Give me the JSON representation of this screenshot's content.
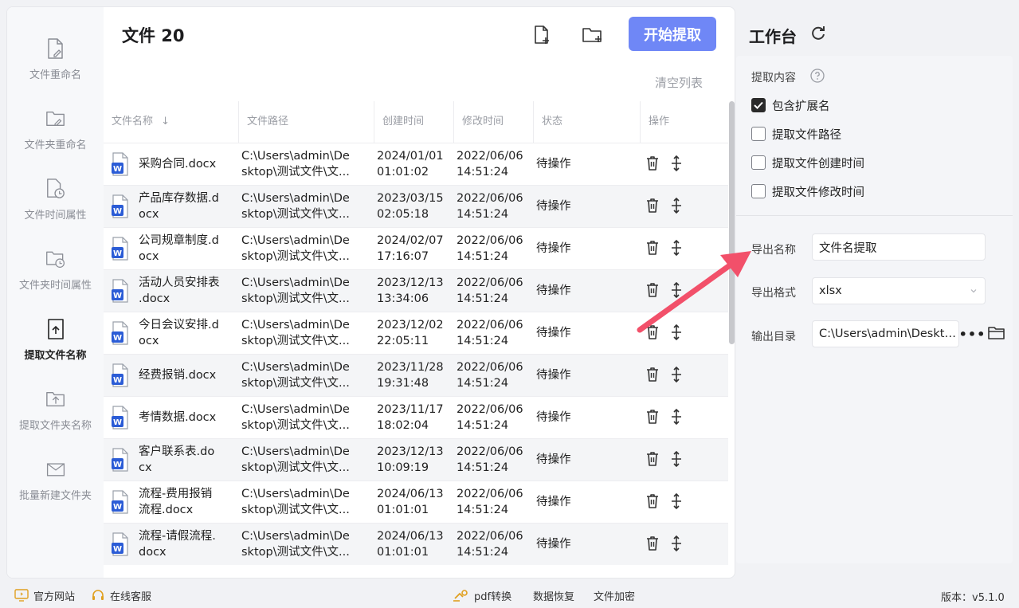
{
  "sidebar": {
    "items": [
      {
        "label": "文件重命名",
        "icon": "file-edit-icon",
        "active": false
      },
      {
        "label": "文件夹重命名",
        "icon": "folder-edit-icon",
        "active": false
      },
      {
        "label": "文件时间属性",
        "icon": "file-clock-icon",
        "active": false
      },
      {
        "label": "文件夹时间属性",
        "icon": "folder-clock-icon",
        "active": false
      },
      {
        "label": "提取文件名称",
        "icon": "file-upload-icon",
        "active": true
      },
      {
        "label": "提取文件夹名称",
        "icon": "folder-upload-icon",
        "active": false
      },
      {
        "label": "批量新建文件夹",
        "icon": "mail-folder-icon",
        "active": false
      }
    ]
  },
  "header": {
    "title": "文件 20",
    "start_button": "开始提取",
    "clear_list": "清空列表"
  },
  "table": {
    "columns": [
      "文件名称",
      "文件路径",
      "创建时间",
      "修改时间",
      "状态",
      "操作"
    ],
    "sort_indicator": "↓",
    "rows": [
      {
        "name": [
          "采购合同.docx"
        ],
        "path": [
          "C:\\Users\\admin\\De",
          "sktop\\测试文件\\文..."
        ],
        "ctime": [
          "2024/01/01",
          "01:01:02"
        ],
        "mtime": [
          "2022/06/06",
          "14:51:24"
        ],
        "status": "待操作"
      },
      {
        "name": [
          "产品库存数据.d",
          "ocx"
        ],
        "path": [
          "C:\\Users\\admin\\De",
          "sktop\\测试文件\\文..."
        ],
        "ctime": [
          "2023/03/15",
          "02:05:18"
        ],
        "mtime": [
          "2022/06/06",
          "14:51:24"
        ],
        "status": "待操作"
      },
      {
        "name": [
          "公司规章制度.d",
          "ocx"
        ],
        "path": [
          "C:\\Users\\admin\\De",
          "sktop\\测试文件\\文..."
        ],
        "ctime": [
          "2024/02/07",
          "17:16:07"
        ],
        "mtime": [
          "2022/06/06",
          "14:51:24"
        ],
        "status": "待操作"
      },
      {
        "name": [
          "活动人员安排表",
          ".docx"
        ],
        "path": [
          "C:\\Users\\admin\\De",
          "sktop\\测试文件\\文..."
        ],
        "ctime": [
          "2023/12/13",
          "13:34:06"
        ],
        "mtime": [
          "2022/06/06",
          "14:51:24"
        ],
        "status": "待操作"
      },
      {
        "name": [
          "今日会议安排.d",
          "ocx"
        ],
        "path": [
          "C:\\Users\\admin\\De",
          "sktop\\测试文件\\文..."
        ],
        "ctime": [
          "2023/12/02",
          "22:05:11"
        ],
        "mtime": [
          "2022/06/06",
          "14:51:24"
        ],
        "status": "待操作"
      },
      {
        "name": [
          "经费报销.docx"
        ],
        "path": [
          "C:\\Users\\admin\\De",
          "sktop\\测试文件\\文..."
        ],
        "ctime": [
          "2023/11/28",
          "19:31:48"
        ],
        "mtime": [
          "2022/06/06",
          "14:51:24"
        ],
        "status": "待操作"
      },
      {
        "name": [
          "考情数据.docx"
        ],
        "path": [
          "C:\\Users\\admin\\De",
          "sktop\\测试文件\\文..."
        ],
        "ctime": [
          "2023/11/17",
          "18:02:04"
        ],
        "mtime": [
          "2022/06/06",
          "14:51:24"
        ],
        "status": "待操作"
      },
      {
        "name": [
          "客户联系表.do",
          "cx"
        ],
        "path": [
          "C:\\Users\\admin\\De",
          "sktop\\测试文件\\文..."
        ],
        "ctime": [
          "2023/12/13",
          "10:09:19"
        ],
        "mtime": [
          "2022/06/06",
          "14:51:24"
        ],
        "status": "待操作"
      },
      {
        "name": [
          "流程-费用报销",
          "流程.docx"
        ],
        "path": [
          "C:\\Users\\admin\\De",
          "sktop\\测试文件\\文..."
        ],
        "ctime": [
          "2024/06/13",
          "01:01:01"
        ],
        "mtime": [
          "2022/06/06",
          "14:51:24"
        ],
        "status": "待操作"
      },
      {
        "name": [
          "流程-请假流程.",
          "docx"
        ],
        "path": [
          "C:\\Users\\admin\\De",
          "sktop\\测试文件\\文..."
        ],
        "ctime": [
          "2024/06/13",
          "01:01:01"
        ],
        "mtime": [
          "2022/06/06",
          "14:51:24"
        ],
        "status": "待操作"
      }
    ]
  },
  "workspace": {
    "title": "工作台",
    "extract_label": "提取内容",
    "options": [
      {
        "label": "包含扩展名",
        "checked": true
      },
      {
        "label": "提取文件路径",
        "checked": false
      },
      {
        "label": "提取文件创建时间",
        "checked": false
      },
      {
        "label": "提取文件修改时间",
        "checked": false
      }
    ],
    "export_name_label": "导出名称",
    "export_name_value": "文件名提取",
    "export_format_label": "导出格式",
    "export_format_value": "xlsx",
    "output_dir_label": "输出目录",
    "output_dir_value": "C:\\Users\\admin\\Desktop",
    "more_label": "•••"
  },
  "footer": {
    "website": "官方网站",
    "support": "在线客服",
    "pdf": "pdf转换",
    "recovery": "数据恢复",
    "encrypt": "文件加密",
    "version": "版本：v5.1.0"
  },
  "colors": {
    "accent": "#6f87f6",
    "arrow": "#f2506a",
    "word_blue": "#2b5cd6"
  }
}
